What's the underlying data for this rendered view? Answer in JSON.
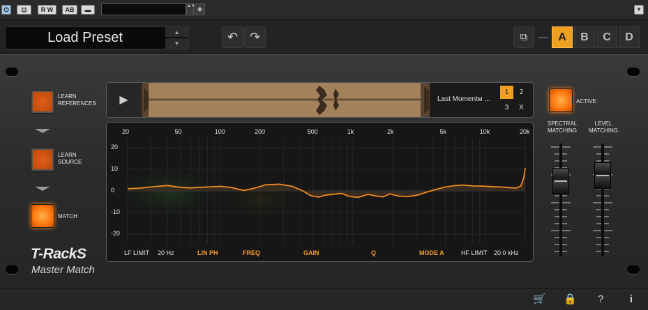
{
  "host": {
    "power_label": "⏻",
    "bypass_label": "⊡",
    "rw_label": "R W",
    "ab_label": "AB",
    "menu_label": "▬",
    "preset_field": "",
    "spin_label": "▲▼",
    "diamond_label": "◈",
    "dropdown_label": "▼"
  },
  "preset": {
    "name": "Load Preset",
    "up": "▲",
    "down": "▼",
    "undo": "↶",
    "redo": "↷",
    "copy": "⧉",
    "slots": [
      {
        "label": "A",
        "active": true
      },
      {
        "label": "B",
        "active": false
      },
      {
        "label": "C",
        "active": false
      },
      {
        "label": "D",
        "active": false
      }
    ]
  },
  "left": {
    "learn_references": "LEARN REFERENCES",
    "learn_source": "LEARN SOURCE",
    "match": "MATCH"
  },
  "logo": {
    "line1": "T-RackS",
    "line2": "Master Match"
  },
  "reference": {
    "play": "▶",
    "name": "Last Momentм ...",
    "slots": [
      "1",
      "2",
      "3",
      "X"
    ],
    "selected": "1"
  },
  "eq": {
    "freq_labels": [
      "20",
      "50",
      "100",
      "200",
      "500",
      "1k",
      "2k",
      "5k",
      "10k",
      "20k"
    ],
    "db_labels": [
      "20",
      "10",
      "0",
      "-10",
      "-20"
    ],
    "lf_limit_label": "LF LIMIT",
    "lf_limit_value": "20 Hz",
    "lin_ph": "LIN PH",
    "freq": "FREQ",
    "gain": "GAIN",
    "q": "Q",
    "mode": "MODE A",
    "hf_limit_label": "HF LIMIT",
    "hf_limit_value": "20.0 kHz",
    "curve_color": "#f08a1e"
  },
  "right": {
    "active": "ACTIVE",
    "spectral_matching": "SPECTRAL MATCHING",
    "level_matching": "LEVEL MATCHING",
    "spectral_level": 0.72,
    "level_level": 0.78
  },
  "footer": {
    "cart": "🛒",
    "lock": "🔒",
    "help": "?",
    "info": "i"
  },
  "colors": {
    "accent": "#f0a020",
    "button_orange": "#e06018"
  }
}
